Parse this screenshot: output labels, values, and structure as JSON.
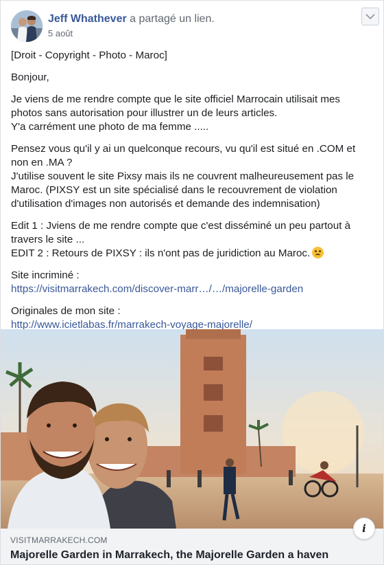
{
  "post": {
    "author": "Jeff Whathever",
    "action": " a partagé un lien.",
    "date": "5 août",
    "avatar_icon": "couple-photo-avatar",
    "menu_icon": "chevron-down-icon"
  },
  "body": {
    "tag": "[Droit - Copyright - Photo - Maroc]",
    "greeting": "Bonjour,",
    "p1_line1": "Je viens de me rendre compte que le site officiel Marrocain utilisait mes",
    "p1_line2": "photos sans autorisation pour illustrer un de leurs articles.",
    "p1_line3": "Y'a carrément une photo de ma femme .....",
    "p2_line1": "Pensez vous qu'il y ai un quelconque recours, vu qu'il est situé en .COM et",
    "p2_line2": "non en .MA ?",
    "p2_line3": "J'utilise souvent le site Pixsy mais ils ne couvrent malheureusement pas le",
    "p2_line4": "Maroc. (PIXSY est un site spécialisé dans le recouvrement de violation",
    "p2_line5": "d'utilisation d'images non autorisés et demande des indemnisation)",
    "p3_line1": "Edit 1 : Jviens de me rendre compte que c'est disséminé un peu partout à",
    "p3_line2": "travers le site ...",
    "p3_line3": "EDIT 2 : Retours de PIXSY : ils n'ont pas de juridiction au Maroc.",
    "emoji_icon": "confused-face-emoji",
    "site_label": "Site incriminé :",
    "site_link": "https://visitmarrakech.com/discover-marr…/…/majorelle-garden",
    "orig_label": "Originales de mon site :",
    "orig_link": "http://www.icietlabas.fr/marrakech-voyage-majorelle/"
  },
  "link_preview": {
    "domain": "VISITMARRAKECH.COM",
    "title": "Majorelle Garden in Marrakech, the Majorelle Garden a haven",
    "info_label": "i",
    "image_icon": "koutoubia-selfie-photo"
  }
}
